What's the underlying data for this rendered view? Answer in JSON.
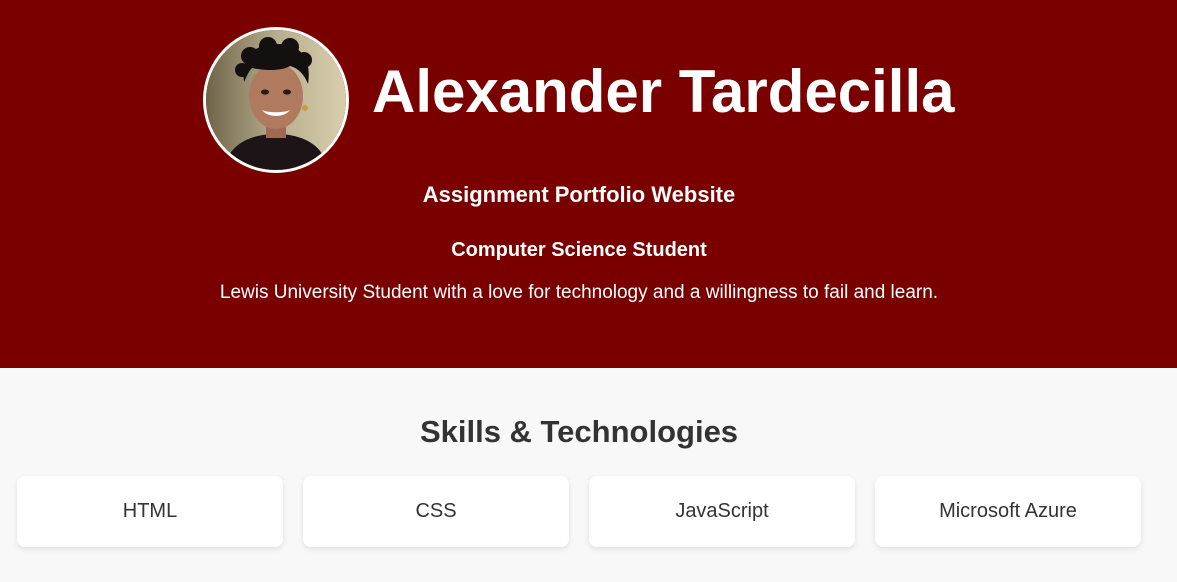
{
  "header": {
    "name": "Alexander Tardecilla",
    "subtitle": "Assignment Portfolio Website",
    "role": "Computer Science Student",
    "tagline": "Lewis University Student with a love for technology and a willingness to fail and learn."
  },
  "skills": {
    "title": "Skills & Technologies",
    "items": [
      {
        "label": "HTML"
      },
      {
        "label": "CSS"
      },
      {
        "label": "JavaScript"
      },
      {
        "label": "Microsoft Azure"
      }
    ]
  },
  "colors": {
    "hero_background": "#7a0000",
    "page_background": "#f8f8f8",
    "text_dark": "#333333",
    "card_background": "#ffffff"
  }
}
